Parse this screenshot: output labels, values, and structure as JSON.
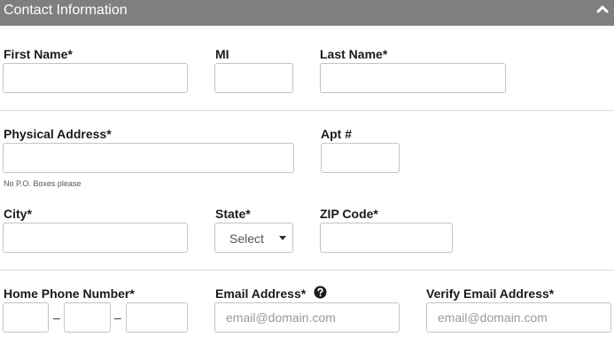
{
  "header": {
    "title": "Contact Information",
    "collapse_icon": "chevron-up-icon"
  },
  "required_marker": "*",
  "fields": {
    "first_name": {
      "label": "First Name",
      "value": ""
    },
    "mi": {
      "label": "MI",
      "value": ""
    },
    "last_name": {
      "label": "Last Name",
      "value": ""
    },
    "physical_address": {
      "label": "Physical Address",
      "value": "",
      "hint": "No P.O. Boxes please"
    },
    "apt": {
      "label": "Apt #",
      "value": ""
    },
    "city": {
      "label": "City",
      "value": ""
    },
    "state": {
      "label": "State",
      "selected": "Select"
    },
    "zip": {
      "label": "ZIP Code",
      "value": ""
    },
    "home_phone": {
      "label": "Home Phone Number",
      "separator": "–"
    },
    "email": {
      "label": "Email Address",
      "placeholder": "email@domain.com",
      "help_icon": "question-circle-icon"
    },
    "verify_email": {
      "label": "Verify Email Address",
      "placeholder": "email@domain.com"
    }
  }
}
